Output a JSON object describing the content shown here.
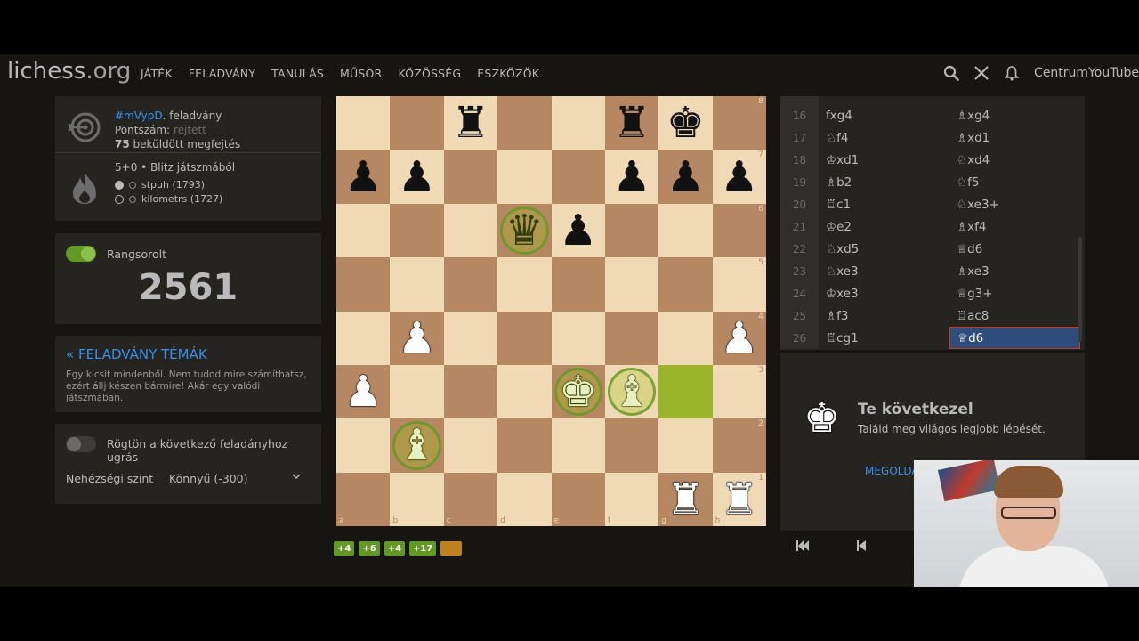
{
  "header": {
    "logo_main": "lichess",
    "logo_tld": ".org",
    "nav": [
      "JÁTÉK",
      "FELADVÁNY",
      "TANULÁS",
      "MŰSOR",
      "KÖZÖSSÉG",
      "ESZKÖZÖK"
    ],
    "username": "CentrumYouTube"
  },
  "puzzle_info": {
    "puzzle_id": "#mVypD",
    "puzzle_suffix": ". feladvány",
    "score_label": "Pontszám:",
    "score_value": "rejtett",
    "solved_count": "75",
    "solved_label": " beküldött megfejtés",
    "game_line": "5+0 • Blitz játszmából",
    "players": [
      {
        "name": "stpuh (1793)"
      },
      {
        "name": "kilometrs (1727)"
      }
    ]
  },
  "rating_panel": {
    "label": "Rangsorolt",
    "value": "2561"
  },
  "themes_panel": {
    "title": "« FELADVÁNY TÉMÁK",
    "description": "Egy kicsit mindenből. Nem tudod mire számíthatsz, ezért állj készen bármire! Akár egy valódi játszmában."
  },
  "settings_panel": {
    "jump_label": "Rögtön a következő feladányhoz ugrás",
    "difficulty_label": "Nehézségi szint",
    "difficulty_value": "Könnyű (-300)"
  },
  "board": {
    "files": [
      "a",
      "b",
      "c",
      "d",
      "e",
      "f",
      "g",
      "h"
    ],
    "ranks": [
      "8",
      "7",
      "6",
      "5",
      "4",
      "3",
      "2",
      "1"
    ],
    "position": [
      [
        "",
        "",
        "r",
        "",
        "",
        "r",
        "k",
        ""
      ],
      [
        "p",
        "p",
        "",
        "",
        "",
        "p",
        "p",
        "p"
      ],
      [
        "",
        "",
        "",
        "q",
        "p",
        "",
        "",
        ""
      ],
      [
        "",
        "",
        "",
        "",
        "",
        "",
        "",
        ""
      ],
      [
        "",
        "P",
        "",
        "",
        "",
        "",
        "",
        "P"
      ],
      [
        "P",
        "",
        "",
        "",
        "K",
        "B",
        "",
        ""
      ],
      [
        "",
        "B",
        "",
        "",
        "",
        "",
        "",
        ""
      ],
      [
        "",
        "",
        "",
        "",
        "",
        "",
        "R",
        "R"
      ]
    ],
    "highlighted_square": "g3",
    "ringed_squares": [
      "d6",
      "e3",
      "f3",
      "b2"
    ]
  },
  "progress_badges": [
    "+4",
    "+6",
    "+4",
    "+17",
    ""
  ],
  "moves": [
    {
      "n": "16",
      "w": "fxg4",
      "b": "♗xg4"
    },
    {
      "n": "17",
      "w": "♘f4",
      "b": "♗xd1"
    },
    {
      "n": "18",
      "w": "♔xd1",
      "b": "♘xd4"
    },
    {
      "n": "19",
      "w": "♗b2",
      "b": "♘f5"
    },
    {
      "n": "20",
      "w": "♖c1",
      "b": "♘xe3+"
    },
    {
      "n": "21",
      "w": "♔e2",
      "b": "♗xf4"
    },
    {
      "n": "22",
      "w": "♘xd5",
      "b": "♕d6"
    },
    {
      "n": "23",
      "w": "♘xe3",
      "b": "♗xe3"
    },
    {
      "n": "24",
      "w": "♔xe3",
      "b": "♕g3+"
    },
    {
      "n": "25",
      "w": "♗f3",
      "b": "♖ac8"
    },
    {
      "n": "26",
      "w": "♖cg1",
      "b": "♕d6"
    }
  ],
  "turn_box": {
    "title": "Te következel",
    "subtitle": "Találd meg világos legjobb lépését.",
    "solution_link": "MEGOLDÁ"
  },
  "piece_glyphs": {
    "K": "♚",
    "Q": "♛",
    "R": "♜",
    "B": "♝",
    "N": "♞",
    "P": "♟",
    "k": "♚",
    "q": "♛",
    "r": "♜",
    "b": "♝",
    "n": "♞",
    "p": "♟"
  },
  "colors": {
    "background": "#161512",
    "panel": "#262421",
    "accent_green": "#629924",
    "link_blue": "#3692e7",
    "light_square": "#f0d9b5",
    "dark_square": "#b58863",
    "move_highlight": "#9bb52b",
    "active_move": "#2e4d7c"
  }
}
